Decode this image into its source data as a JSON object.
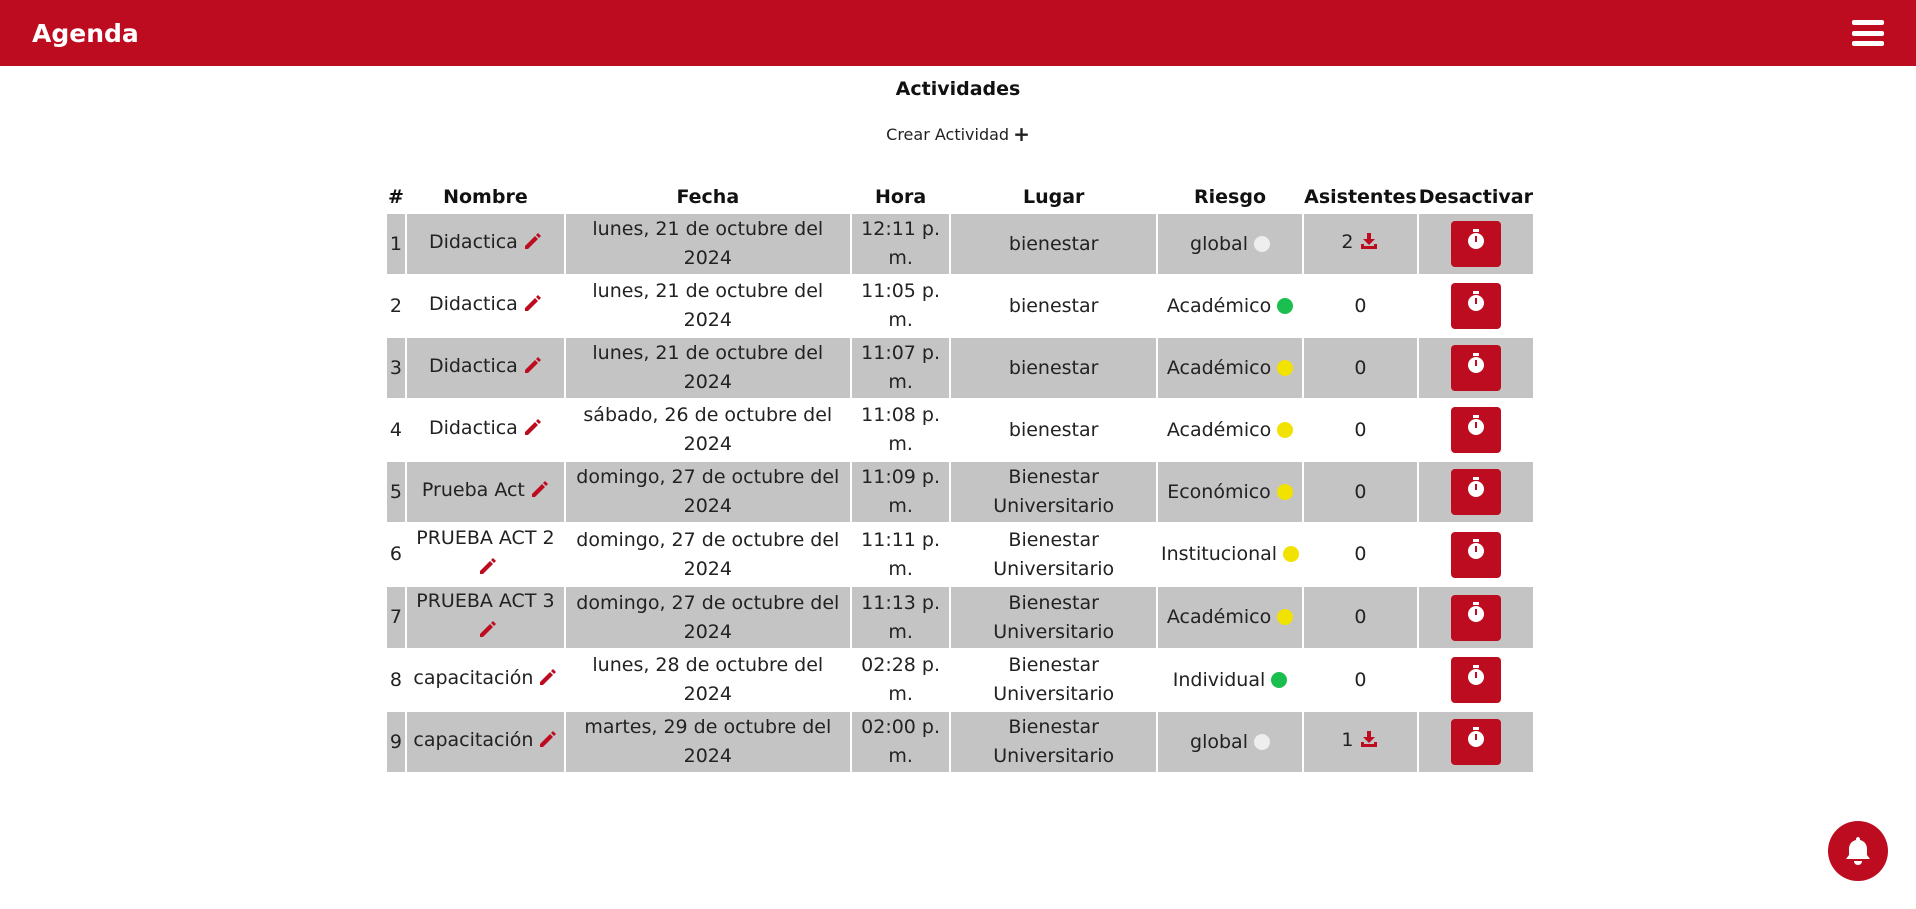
{
  "header": {
    "brand": "Agenda",
    "menu_icon": "hamburger-menu-icon"
  },
  "page": {
    "title": "Actividades",
    "create_label": "Crear Actividad",
    "create_icon": "plus-icon"
  },
  "table": {
    "columns": [
      "#",
      "Nombre",
      "Fecha",
      "Hora",
      "Lugar",
      "Riesgo",
      "Asistentes",
      "Desactivar"
    ],
    "rows": [
      {
        "num": "1",
        "nombre": "Didactica",
        "fecha": "lunes, 21 de octubre del 2024",
        "hora": "12:11 p. m.",
        "lugar": "bienestar",
        "riesgo": "global",
        "riesgo_color": "#eeeeee",
        "asistentes": "2",
        "download": true
      },
      {
        "num": "2",
        "nombre": "Didactica",
        "fecha": "lunes, 21 de octubre del 2024",
        "hora": "11:05 p. m.",
        "lugar": "bienestar",
        "riesgo": "Académico",
        "riesgo_color": "#1bbf4f",
        "asistentes": "0",
        "download": false
      },
      {
        "num": "3",
        "nombre": "Didactica",
        "fecha": "lunes, 21 de octubre del 2024",
        "hora": "11:07 p. m.",
        "lugar": "bienestar",
        "riesgo": "Académico",
        "riesgo_color": "#f2e200",
        "asistentes": "0",
        "download": false
      },
      {
        "num": "4",
        "nombre": "Didactica",
        "fecha": "sábado, 26 de octubre del 2024",
        "hora": "11:08 p. m.",
        "lugar": "bienestar",
        "riesgo": "Académico",
        "riesgo_color": "#f2e200",
        "asistentes": "0",
        "download": false
      },
      {
        "num": "5",
        "nombre": "Prueba Act",
        "fecha": "domingo, 27 de octubre del 2024",
        "hora": "11:09 p. m.",
        "lugar": "Bienestar Universitario",
        "riesgo": "Económico",
        "riesgo_color": "#f2e200",
        "asistentes": "0",
        "download": false
      },
      {
        "num": "6",
        "nombre": "PRUEBA ACT 2",
        "fecha": "domingo, 27 de octubre del 2024",
        "hora": "11:11 p. m.",
        "lugar": "Bienestar Universitario",
        "riesgo": "Institucional",
        "riesgo_color": "#f2e200",
        "asistentes": "0",
        "download": false
      },
      {
        "num": "7",
        "nombre": "PRUEBA ACT 3",
        "fecha": "domingo, 27 de octubre del 2024",
        "hora": "11:13 p. m.",
        "lugar": "Bienestar Universitario",
        "riesgo": "Académico",
        "riesgo_color": "#f2e200",
        "asistentes": "0",
        "download": false
      },
      {
        "num": "8",
        "nombre": "capacitación",
        "fecha": "lunes, 28 de octubre del 2024",
        "hora": "02:28 p. m.",
        "lugar": "Bienestar Universitario",
        "riesgo": "Individual",
        "riesgo_color": "#1bbf4f",
        "asistentes": "0",
        "download": false
      },
      {
        "num": "9",
        "nombre": "capacitación",
        "fecha": "martes, 29 de octubre del 2024",
        "hora": "02:00 p. m.",
        "lugar": "Bienestar Universitario",
        "riesgo": "global",
        "riesgo_color": "#eeeeee",
        "asistentes": "1",
        "download": true
      }
    ]
  },
  "colors": {
    "brand": "#bd0c20",
    "row_shade": "#c4c4c4"
  },
  "notification": {
    "icon": "bell-icon"
  }
}
